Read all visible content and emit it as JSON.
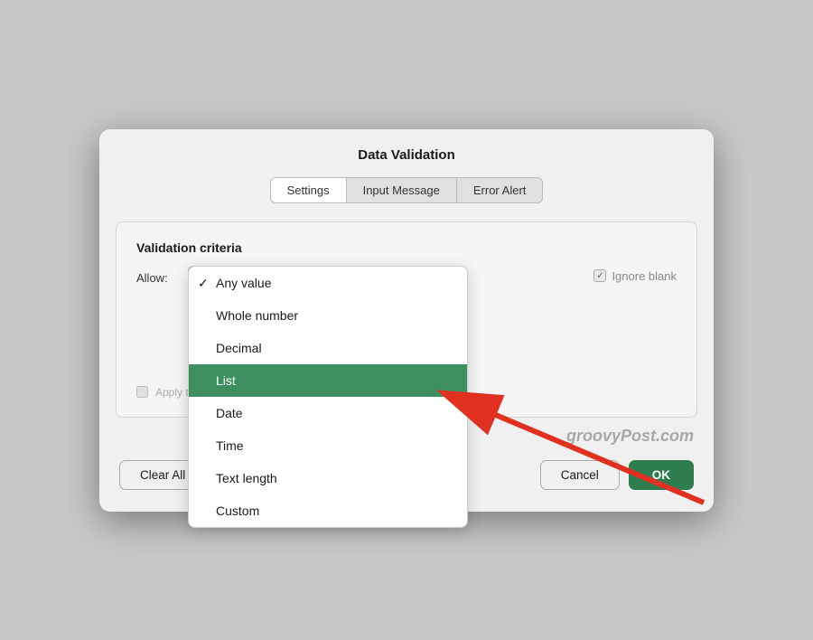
{
  "dialog": {
    "title": "Data Validation",
    "tabs": [
      {
        "label": "Settings",
        "active": true
      },
      {
        "label": "Input Message",
        "active": false
      },
      {
        "label": "Error Alert",
        "active": false
      }
    ],
    "body": {
      "section_title": "Validation criteria",
      "allow_label": "Allow:",
      "dropdown": {
        "selected_value": "List",
        "items": [
          {
            "label": "Any value",
            "checked": true,
            "selected": false
          },
          {
            "label": "Whole number",
            "checked": false,
            "selected": false
          },
          {
            "label": "Decimal",
            "checked": false,
            "selected": false
          },
          {
            "label": "List",
            "checked": false,
            "selected": true
          },
          {
            "label": "Date",
            "checked": false,
            "selected": false
          },
          {
            "label": "Time",
            "checked": false,
            "selected": false
          },
          {
            "label": "Text length",
            "checked": false,
            "selected": false
          },
          {
            "label": "Custom",
            "checked": false,
            "selected": false
          }
        ]
      },
      "ignore_blank": {
        "label": "Ignore blank",
        "checked": true
      },
      "apply_label": "Apply these changes to all other cells with the same settings"
    },
    "watermark": "groovyPost.com",
    "footer": {
      "clear_all": "Clear All",
      "cancel": "Cancel",
      "ok": "OK"
    }
  }
}
